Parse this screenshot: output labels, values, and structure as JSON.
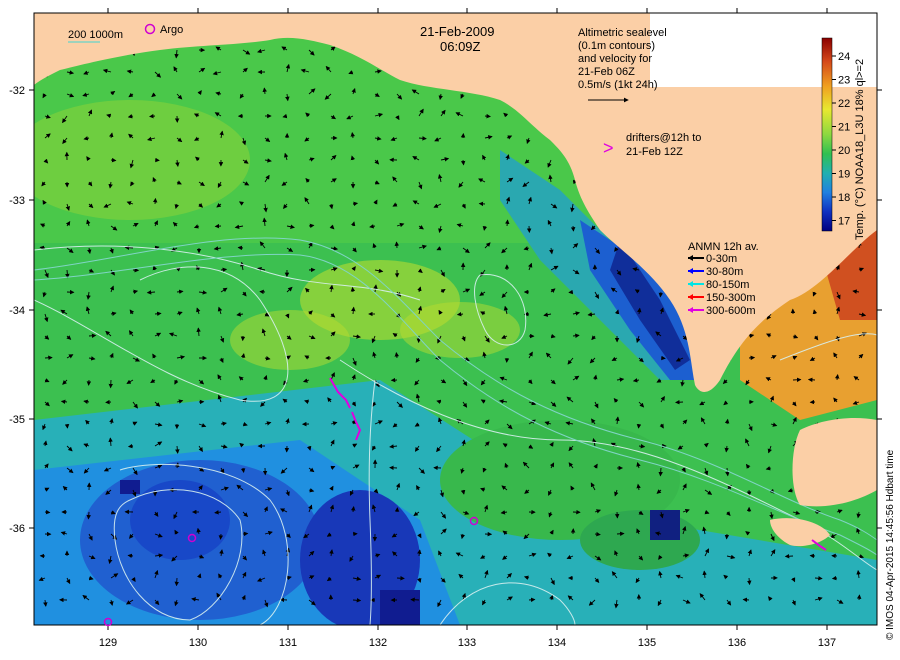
{
  "map": {
    "title_date": "21-Feb-2009",
    "title_time": "06:09Z",
    "bathymetry_legend": {
      "label": "200  1000m",
      "color": "#7fd4c4"
    },
    "argo_legend": {
      "label": "Argo",
      "color": "#d000d0"
    },
    "altimetry_note": [
      "Altimetric sealevel",
      "(0.1m contours)",
      "and velocity for",
      "21-Feb 06Z",
      "0.5m/s (1kt 24h)"
    ],
    "drifters_note": [
      "drifters@12h to",
      "21-Feb 12Z"
    ],
    "drifter_marker": ">",
    "drifter_color": "#e000e0",
    "anmn": {
      "title": "ANMN 12h av.",
      "items": [
        {
          "label": "0-30m",
          "color": "#000000"
        },
        {
          "label": "30-80m",
          "color": "#0000ff"
        },
        {
          "label": "80-150m",
          "color": "#00e5e5"
        },
        {
          "label": "150-300m",
          "color": "#ff0000"
        },
        {
          "label": "300-600m",
          "color": "#e000e0"
        }
      ]
    },
    "colorbar": {
      "ticks": [
        "24",
        "23",
        "22",
        "21",
        "20",
        "19",
        "18",
        "17"
      ],
      "label": "Temp. (°C) NOAA18_L3U 18% ql>=2",
      "colors": [
        "#8b0000",
        "#d4481a",
        "#f0a020",
        "#e8e830",
        "#8cd840",
        "#30c050",
        "#20b0b0",
        "#2080e0",
        "#1030c0",
        "#000080"
      ]
    },
    "x_ticks": [
      "129",
      "130",
      "131",
      "132",
      "133",
      "134",
      "135",
      "136",
      "137"
    ],
    "y_ticks": [
      "-32",
      "-33",
      "-34",
      "-35",
      "-36"
    ],
    "land_color": "#fbcfa6",
    "credit": "© IMOS 04-Apr-2015 14:45:56 Hdbart time"
  }
}
